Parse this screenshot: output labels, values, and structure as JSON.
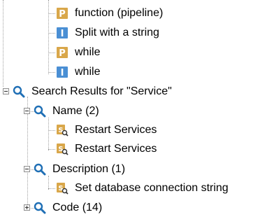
{
  "tree": {
    "items": [
      {
        "label": "function (pipeline)",
        "icon": "p-document-icon"
      },
      {
        "label": "Split with a string",
        "icon": "i-document-icon"
      },
      {
        "label": "while",
        "icon": "p-document-icon"
      },
      {
        "label": "while",
        "icon": "i-document-icon"
      }
    ],
    "search_results": {
      "label": "Search Results for \"Service\"",
      "icon": "magnifier-icon",
      "groups": [
        {
          "label": "Name (2)",
          "icon": "magnifier-icon",
          "expanded": true,
          "children": [
            {
              "label": "Restart Services",
              "icon": "script-search-icon"
            },
            {
              "label": "Restart Services",
              "icon": "script-search-icon"
            }
          ]
        },
        {
          "label": "Description (1)",
          "icon": "magnifier-icon",
          "expanded": true,
          "children": [
            {
              "label": "Set database connection string",
              "icon": "script-search-icon"
            }
          ]
        },
        {
          "label": "Code (14)",
          "icon": "magnifier-icon",
          "expanded": false,
          "children": []
        }
      ]
    }
  },
  "colors": {
    "p_icon": "#d9a74a",
    "i_icon": "#4a8fd4",
    "magnifier": "#1f6fb5",
    "connector": "#a0a0a0"
  }
}
